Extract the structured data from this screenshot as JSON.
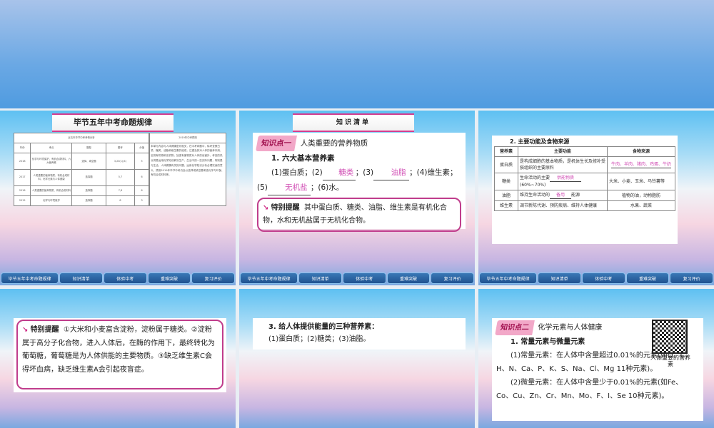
{
  "nav": [
    "毕节五年中考命题规律",
    "知识清单",
    "体验中考",
    "重难突破",
    "复习评价"
  ],
  "slide1": {
    "title": "毕节五年中考命题规律",
    "table_caption": "近五年毕节中考考情分析",
    "forecast_caption": "2019年中考预测",
    "headers": [
      "年份",
      "考点",
      "题型",
      "题号",
      "分值"
    ],
    "rows": [
      [
        "2018",
        "化学与环境保护、有机合成材料、六大营养素",
        "选择、填空题",
        "3,20(1)(4)",
        "5"
      ],
      [
        "2017",
        "人类重要的营养物质、有机合成材料、化学元素与人体健康",
        "选择题",
        "5,7",
        "6"
      ],
      [
        "2016",
        "人类重要的营养物质、有机合成材料",
        "选择题",
        "7,8",
        "6"
      ],
      [
        "2015",
        "化学与环境保护",
        "选择题",
        "8",
        "3"
      ]
    ],
    "forecast": "本单元内容与人体健康密切相关，在中考命题中，除考查蛋白质、糖类、油脂和维生素的组成，注重及其对人体的营养作用，区别有机物和无机物，加强有害物质对人体的危害外，考查的热点将是运用化学知识解决生产、生活中的一些实际问题，特别是与生活、人体健康有关的问题，运用化学知识分析合理饮食的意义。预测2019年毕节中考仍会以选择或填空题考查化学与环保、有机合成材料等。"
  },
  "slide2": {
    "title": "知识清单",
    "tag": "知识点一",
    "heading": "人类重要的营养物质",
    "sub": "1. 六大基本营养素",
    "p1": "(1)蛋白质；(2)",
    "a1": "糖类",
    "p2": "；(3)",
    "a2": "油脂",
    "p3": "；(4)维生素；(5)",
    "a3": "无机盐",
    "p4": "；(6)水。",
    "note_label": "特别提醒",
    "note": "其中蛋白质、糖类、油脂、维生素是有机化合物，水和无机盐属于无机化合物。"
  },
  "slide3": {
    "sub": "2. 主要功能及食物来源",
    "headers": [
      "营养素",
      "主要功能",
      "食物来源"
    ],
    "rows": [
      {
        "name": "蛋白质",
        "func": "是构成细胞的基本物质，是机体生长及修补受损组织的主要原料",
        "func_ans": "",
        "func_tail": "",
        "src": "",
        "src_ans": "牛肉、羊肉、猪肉、鸡蛋、牛奶"
      },
      {
        "name": "糖类",
        "func": "生命活动的主要",
        "func_ans": "供能物质",
        "func_tail": "(60%~70%)",
        "src": "大米、小麦、玉米、马铃薯等",
        "src_ans": ""
      },
      {
        "name": "油脂",
        "func": "维持生命活动的",
        "func_ans": "备用",
        "func_tail": "能源",
        "src": "植物的油，动物脂肪",
        "src_ans": ""
      },
      {
        "name": "维生素",
        "func": "调节新陈代谢、预防疾病、维持人体健康",
        "func_ans": "",
        "func_tail": "",
        "src": "水果、蔬菜",
        "src_ans": ""
      }
    ]
  },
  "slide4": {
    "note_label": "特别提醒",
    "note": "①大米和小麦富含淀粉，淀粉属于糖类。②淀粉属于高分子化合物，进入人体后，在酶的作用下，最终转化为葡萄糖，葡萄糖是为人体供能的主要物质。③缺乏维生素C会得坏血病，缺乏维生素A会引起夜盲症。"
  },
  "slide5": {
    "sub": "3. 给人体提供能量的三种营养素：",
    "text": "(1)蛋白质；(2)糖类；(3)油脂。"
  },
  "slide6": {
    "tag": "知识点二",
    "heading": "化学元素与人体健康",
    "sub": "1. 常量元素与微量元素",
    "p1": "(1)常量元素：在人体中含量超过0.01%的元素(如O、C、H、N、Ca、P、K、S、Na、Cl、Mg 11种元素)。",
    "p2": "(2)微量元素：在人体中含量少于0.01%的元素(如Fe、Co、Cu、Zn、Cr、Mn、Mo、F、I、Se 10种元素)。",
    "qr_caption": "人体重要的营养素"
  }
}
